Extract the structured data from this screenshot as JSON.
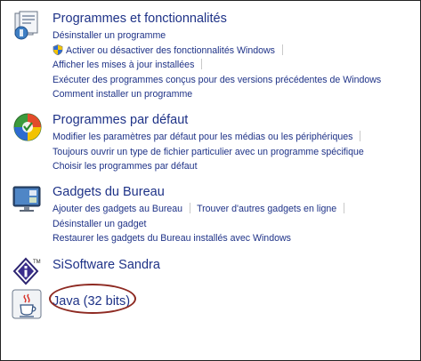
{
  "sections": [
    {
      "title": "Programmes et fonctionnalités",
      "icon": "programs-features-icon",
      "links": [
        [
          "Désinstaller un programme"
        ],
        [
          "Activer ou désactiver des fonctionnalités Windows"
        ],
        [
          "Afficher les mises à jour installées"
        ],
        [
          "Exécuter des programmes conçus pour des versions précédentes de Windows"
        ],
        [
          "Comment installer un programme"
        ]
      ]
    },
    {
      "title": "Programmes par défaut",
      "icon": "default-programs-icon",
      "links": [
        [
          "Modifier les paramètres par défaut pour les médias ou les périphériques"
        ],
        [
          "Toujours ouvrir un type de fichier particulier avec un programme spécifique"
        ],
        [
          "Choisir les programmes par défaut"
        ]
      ]
    },
    {
      "title": "Gadgets du Bureau",
      "icon": "desktop-gadgets-icon",
      "links": [
        [
          "Ajouter des gadgets au Bureau",
          "Trouver d'autres gadgets en ligne"
        ],
        [
          "Désinstaller un gadget"
        ],
        [
          "Restaurer les gadgets du Bureau installés avec Windows"
        ]
      ]
    },
    {
      "title": "SiSoftware Sandra",
      "icon": "sisoftware-sandra-icon",
      "logo_text": "TM",
      "links": []
    },
    {
      "title": "Java (32 bits)",
      "icon": "java-icon",
      "highlight_color": "#8e2a22",
      "links": []
    }
  ],
  "colors": {
    "link": "#1e3287",
    "highlight": "#8e2a22"
  }
}
